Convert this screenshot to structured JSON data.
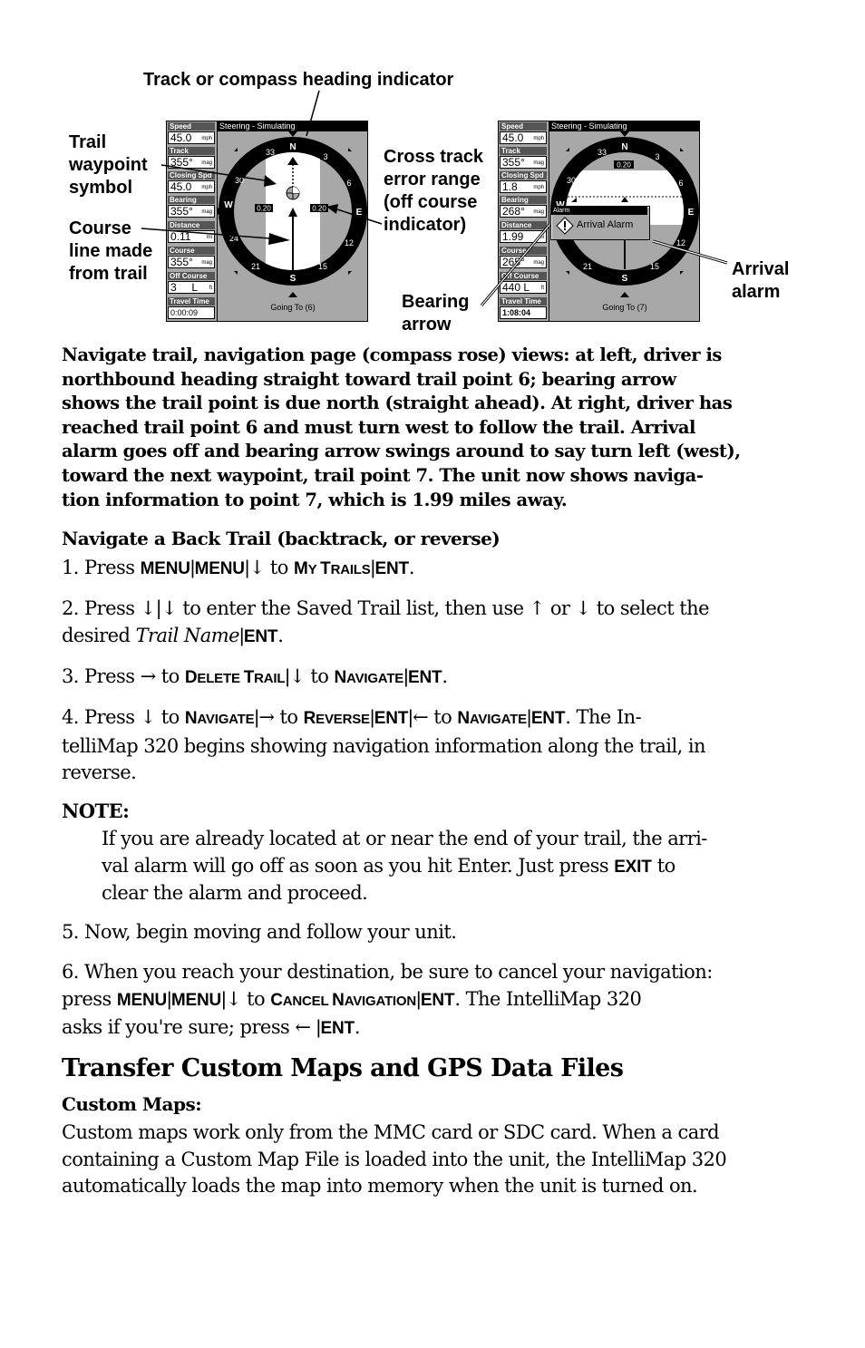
{
  "figure": {
    "callouts": {
      "heading_indicator": "Track or compass heading indicator",
      "trail_waypoint": [
        "Trail",
        "waypoint",
        "symbol"
      ],
      "course_line": [
        "Course",
        "line made",
        "from trail"
      ],
      "cross_track": [
        "Cross track",
        "error range",
        "(off course",
        "indicator)"
      ],
      "bearing_arrow": [
        "Bearing",
        "arrow"
      ],
      "arrival_alarm": [
        "Arrival",
        "alarm"
      ]
    },
    "left_screen": {
      "title": "Steering - Simulating",
      "going_to": "Going To (6)",
      "fields": [
        {
          "label": "Speed",
          "value": "45.0",
          "unit": "mph"
        },
        {
          "label": "Track",
          "value": "355°",
          "unit": "mag"
        },
        {
          "label": "Closing Spd",
          "value": "45.0",
          "unit": "mph"
        },
        {
          "label": "Bearing",
          "value": "355°",
          "unit": "mag"
        },
        {
          "label": "Distance",
          "value": "0.11",
          "unit": "mi"
        },
        {
          "label": "Course",
          "value": "355°",
          "unit": "mag"
        },
        {
          "label": "Off Course",
          "value": "3     L",
          "unit": "ft"
        },
        {
          "label": "Travel Time",
          "value": "0:00:09",
          "unit": ""
        }
      ],
      "xte_left": "0.20",
      "xte_right": "0.20",
      "compass": {
        "N": "N",
        "E": "E",
        "S": "S",
        "W": "W",
        "n3": "3",
        "n6": "6",
        "n12": "12",
        "n15": "15",
        "n21": "21",
        "n24": "24",
        "n30": "30",
        "n33": "33"
      }
    },
    "right_screen": {
      "title": "Steering - Simulating",
      "going_to": "Going To (7)",
      "fields": [
        {
          "label": "Speed",
          "value": "45.0",
          "unit": "mph"
        },
        {
          "label": "Track",
          "value": "355°",
          "unit": "mag"
        },
        {
          "label": "Closing Spd",
          "value": "1.8",
          "unit": "mph"
        },
        {
          "label": "Bearing",
          "value": "268°",
          "unit": "mag"
        },
        {
          "label": "Distance",
          "value": "1.99",
          "unit": "mi"
        },
        {
          "label": "Course",
          "value": "265°",
          "unit": "mag"
        },
        {
          "label": "Off Course",
          "value": "440 L",
          "unit": "ft"
        },
        {
          "label": "Travel Time",
          "value": "1:08:04",
          "unit": ""
        }
      ],
      "xte_top": "0.20",
      "alarm": {
        "title": "Alarm",
        "message": "Arrival Alarm"
      },
      "compass": {
        "N": "N",
        "E": "E",
        "S": "S",
        "W": "W",
        "n3": "3",
        "n6": "6",
        "n12": "12",
        "n15": "15",
        "n21": "21",
        "n30": "30",
        "n33": "33"
      }
    }
  },
  "caption": "Navigate trail, navigation page (compass rose) views: at left, driver is northbound heading straight toward trail point 6; bearing arrow shows the trail point is due north (straight ahead). At right, driver has reached trail point 6 and must turn west to follow the trail. Arrival alarm goes off and bearing arrow swings around to say turn left (west), toward the next waypoint, trail point 7. The unit now shows naviga-tion information to point 7, which is 1.99 miles away.",
  "caption_lines": [
    "Navigate trail, navigation page (compass rose) views: at left, driver is",
    "northbound heading straight toward trail point 6; bearing arrow",
    "shows the trail point is due north (straight ahead). At right, driver has",
    "reached trail point 6 and must turn west to follow the trail. Arrival",
    "alarm goes off and bearing arrow swings around to say turn left (west),",
    "toward the next waypoint, trail point 7. The unit now shows naviga-",
    "tion information to point 7, which is 1.99 miles away."
  ],
  "section_backtrail": {
    "heading": "Navigate a Back Trail (backtrack, or reverse)",
    "step1": {
      "prefix": "1. Press ",
      "k1": "MENU",
      "k2": "MENU",
      "down": "↓",
      "to": " to ",
      "m1": "M",
      "m1s": "Y ",
      "m2": "T",
      "m2s": "RAILS",
      "ent": "ENT",
      "end": "."
    },
    "step2": {
      "text1": "2. Press ↓|↓ to enter the Saved Trail list, then use ↑ or ↓ to select the",
      "text2a": "desired ",
      "italic": "Trail Name",
      "ent": "ENT",
      "end": "."
    },
    "step3": {
      "prefix": "3. Press → to ",
      "d1": "D",
      "d1s": "ELETE ",
      "d2": "T",
      "d2s": "RAIL",
      "mid": "↓ to ",
      "n1": "N",
      "n1s": "AVIGATE",
      "ent": "ENT",
      "end": "."
    },
    "step4": {
      "prefix": "4. Press ↓ to ",
      "n1": "N",
      "n1s": "AVIGATE",
      "arrow_r": "→ to ",
      "r1": "R",
      "r1s": "EVERSE",
      "ent": "ENT",
      "arrow_l": "← to ",
      "n2": "N",
      "n2s": "AVIGATE",
      "ent2": "ENT",
      "tail1": ". The In-",
      "line2": "telliMap 320 begins showing navigation information along the trail, in",
      "line3": "reverse."
    },
    "note_label": "NOTE:",
    "note": {
      "line1": "If you are already located at or near the end of your trail, the arri-",
      "line2a": "val alarm will go off as soon as you hit Enter. Just press ",
      "exit": "EXIT",
      "line2b": " to",
      "line3": "clear the alarm and proceed."
    },
    "step5": "5. Now, begin moving and follow your unit.",
    "step6": {
      "line1": "6. When you reach your destination, be sure to cancel your navigation:",
      "press": "press ",
      "k1": "MENU",
      "k2": "MENU",
      "down": "↓",
      "to": " to ",
      "c1": "C",
      "c1s": "ANCEL ",
      "c2": "N",
      "c2s": "AVIGATION",
      "ent": "ENT",
      "tail": ". The IntelliMap 320",
      "line3a": "asks if you're sure; press ",
      "left": "←",
      "ent2": "ENT",
      "end": "."
    }
  },
  "section_transfer": {
    "heading": "Transfer Custom Maps and GPS Data Files",
    "subheading": "Custom Maps:",
    "lines": [
      "Custom maps work only from the MMC card or SDC card. When a card",
      "containing a Custom Map File is loaded into the unit, the IntelliMap 320",
      "automatically loads the map into memory when the unit is turned on."
    ]
  }
}
